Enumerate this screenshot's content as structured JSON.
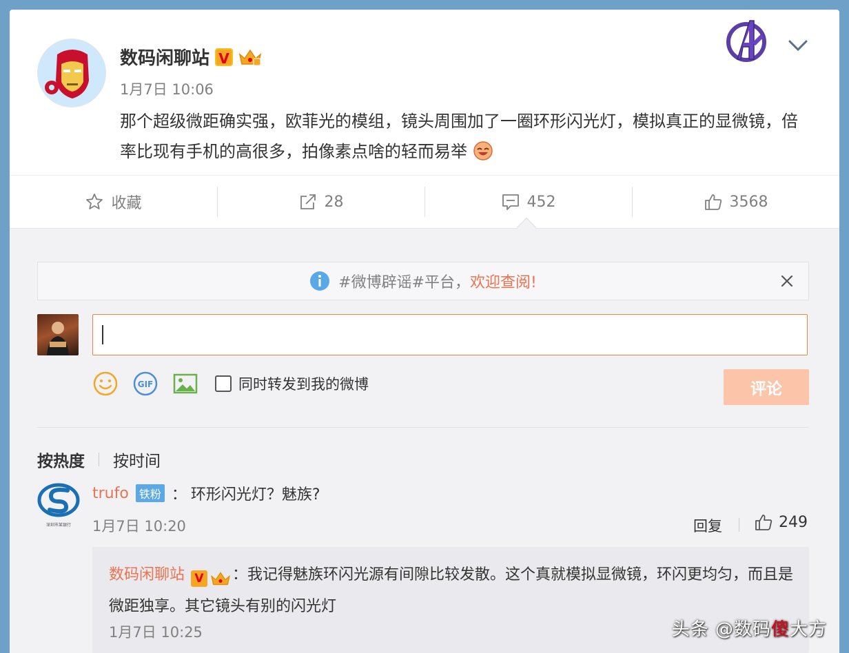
{
  "post": {
    "author": "数码闲聊站",
    "vip_letter": "V",
    "time": "1月7日 10:06",
    "text": "那个超级微距确实强，欧菲光的模组，镜头周围加了一圈环形闪光灯，模拟真正的显微镜，倍率比现有手机的高很多，拍像素点啥的轻而易举"
  },
  "actions": {
    "favorite": "收藏",
    "repost_count": "28",
    "comment_count": "452",
    "like_count": "3568"
  },
  "notice": {
    "prefix": "#微博辟谣#平台，",
    "highlight": "欢迎查阅!"
  },
  "composer": {
    "input_value": "",
    "repost_label": "同时转发到我的微博",
    "submit_label": "评论"
  },
  "sort": {
    "hot": "按热度",
    "time": "按时间"
  },
  "comment": {
    "user": "trufo",
    "badge": "铁粉",
    "colon": "：",
    "text": "环形闪光灯？魅族?",
    "time": "1月7日 10:20",
    "reply_label": "回复",
    "likes": "249",
    "avatar_caption": "深圳市某银行"
  },
  "reply": {
    "user": "数码闲聊站",
    "vip_letter": "V",
    "colon": "：",
    "text": "我记得魅族环闪光源有间隙比较发散。这个真就模拟显微镜，环闪更均匀，而且是微距独享。其它镜头有别的闪光灯",
    "time": "1月7日 10:25"
  },
  "watermark": {
    "pre": "头条 @数码",
    "heart": "傻",
    "post": "大方"
  },
  "colors": {
    "accent": "#eb7350",
    "link_orange": "#f0843c",
    "submit_disabled": "#fcc4a8",
    "fan_badge": "#5aa9e6",
    "background": "#6fa0c8"
  },
  "icons": {
    "favorite": "star-icon",
    "repost": "share-arrow-icon",
    "comment": "comment-bubble-icon",
    "like": "thumbs-up-icon",
    "notice": "info-circle-icon",
    "close": "close-icon",
    "emoji": "smiley-icon",
    "gif": "gif-icon",
    "image": "image-icon",
    "expand": "chevron-down-icon"
  }
}
